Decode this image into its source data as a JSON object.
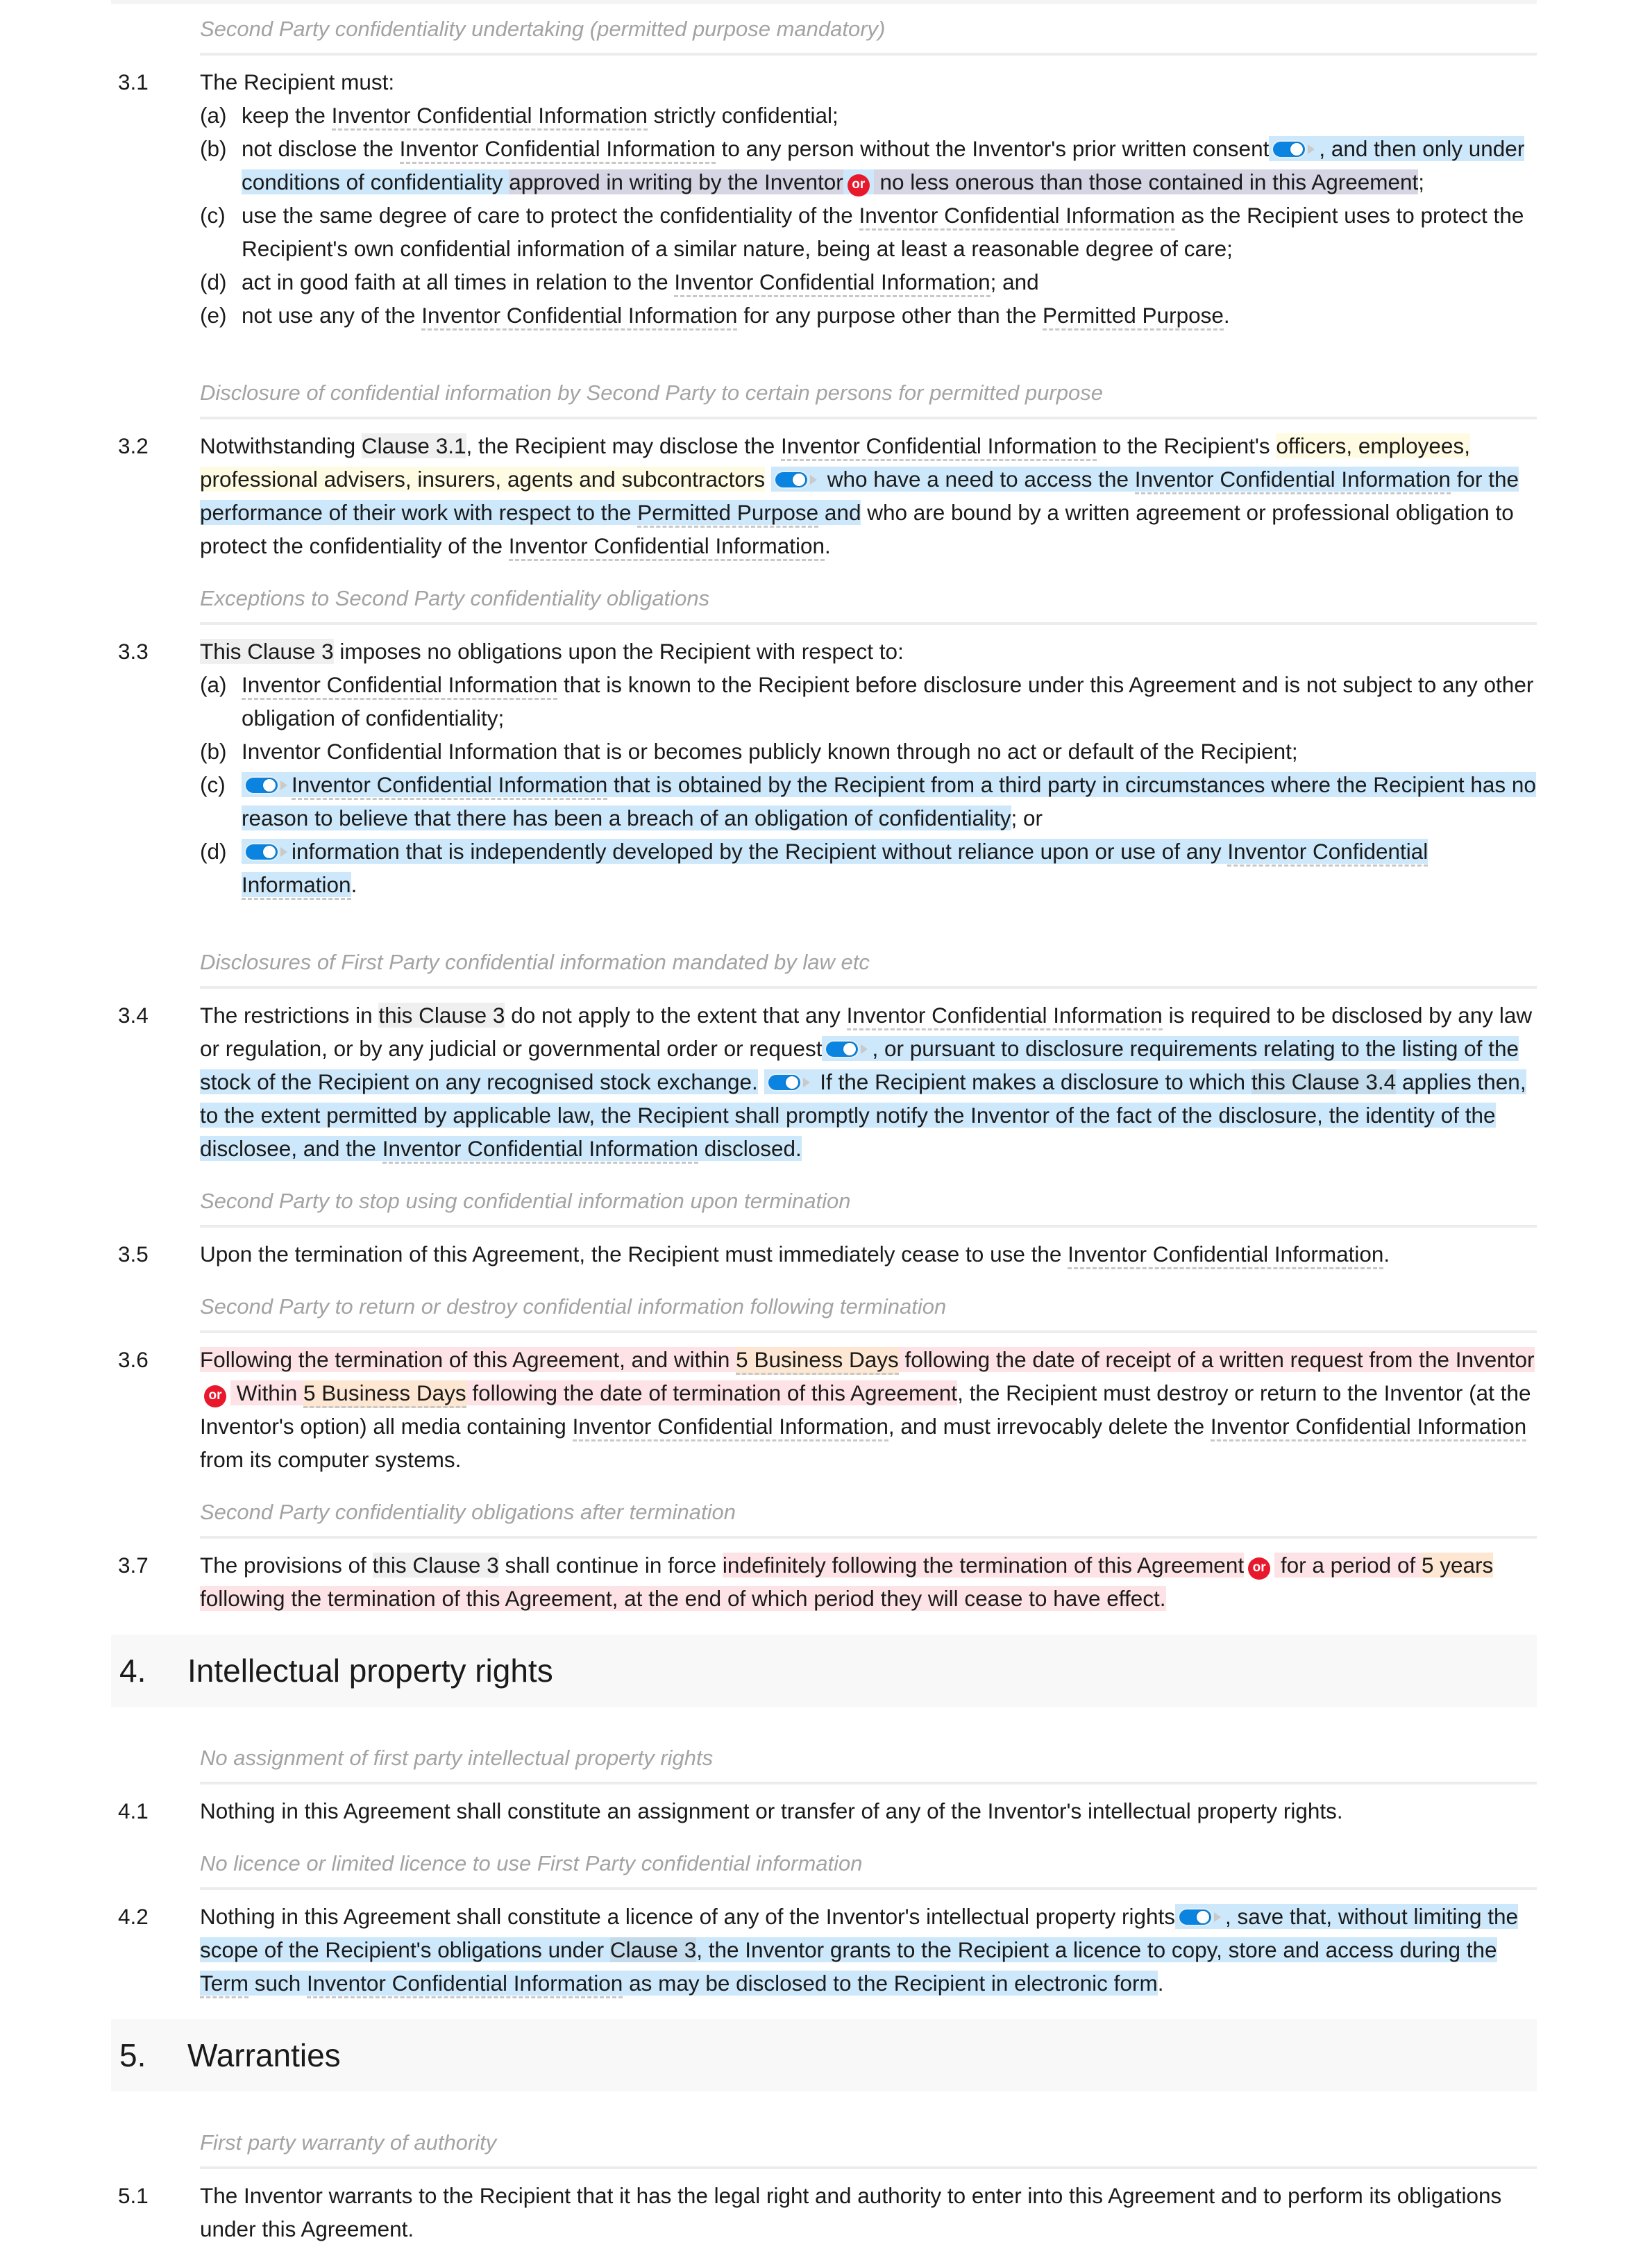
{
  "colors": {
    "optional_clause_bg": "#cde8fa",
    "alternative_bg": "#d5d5e3",
    "variable_bg": "#fffbe3",
    "choice_bg": "#fde3e5",
    "value_bg": "#fde7d2",
    "toggle_on": "#0a84e0",
    "or_badge": "#e8192c",
    "guidance_text": "#a3a3a3"
  },
  "or_label": "or",
  "s3_1": {
    "guidance": "Second Party confidentiality undertaking (permitted purpose mandatory)",
    "num": "3.1",
    "intro": "The Recipient must:",
    "a": {
      "lbl": "(a)",
      "t1": "keep the ",
      "term": "Inventor Confidential Information",
      "t2": " strictly confidential;"
    },
    "b": {
      "lbl": "(b)",
      "t1": "not disclose the ",
      "term": "Inventor Confidential Information",
      "t2": " to any person without the Inventor's prior written consent",
      "opt1": ", and then only under conditions of confidentiality ",
      "alt1": "approved in writing by the Inventor",
      "alt2a": " no less onerous than those contained in this Agreement",
      "t3": ";"
    },
    "c": {
      "lbl": "(c)",
      "t1": "use the same degree of care to protect the confidentiality of the ",
      "term": "Inventor Confidential Information",
      "t2": " as the Recipient uses to protect the Recipient's own confidential information of a similar nature, being at least a reasonable degree of care;"
    },
    "d": {
      "lbl": "(d)",
      "t1": "act in good faith at all times in relation to the ",
      "term": "Inventor Confidential Information",
      "t2": "; and"
    },
    "e": {
      "lbl": "(e)",
      "t1": "not use any of the ",
      "term": "Inventor Confidential Information",
      "t2": " for any purpose other than the ",
      "term2": "Permitted Purpose",
      "t3": "."
    }
  },
  "s3_2": {
    "guidance": "Disclosure of confidential information by Second Party to certain persons for permitted purpose",
    "num": "3.2",
    "t1": "Notwithstanding ",
    "xref": "Clause 3.1",
    "t2": ", the Recipient may disclose the ",
    "term": "Inventor Confidential Information",
    "t3": " to the Recipient's ",
    "var": "officers, employees, professional advisers, insurers, agents and subcontractors",
    "opt1": " who have a need to access the ",
    "opt_term": "Inventor Confidential Information",
    "opt2": " for the performance of their work with respect to the ",
    "opt_term2": "Permitted Purpose",
    "opt3": " and",
    "t4": " who are bound by a written agreement or professional obligation to protect the confidentiality of the ",
    "term2": "Inventor Confidential Information",
    "t5": "."
  },
  "s3_3": {
    "guidance": "Exceptions to Second Party confidentiality obligations",
    "num": "3.3",
    "xref": "This Clause 3",
    "intro": " imposes no obligations upon the Recipient with respect to:",
    "a": {
      "lbl": "(a)",
      "term": "Inventor Confidential Information",
      "t1": " that is known to the Recipient before disclosure under this Agreement and is not subject to any other obligation of confidentiality;"
    },
    "b": {
      "lbl": "(b)",
      "t1": "Inventor Confidential Information that is or becomes publicly known through no act or default of the Recipient;"
    },
    "c": {
      "lbl": "(c)",
      "term": "Inventor Confidential Information",
      "t1": " that is obtained by the Recipient from a third party in circumstances where the Recipient has no reason to believe that there has been a breach of an obligation of confidentiality",
      "t2": "; or"
    },
    "d": {
      "lbl": "(d)",
      "t1": "information that is independently developed by the Recipient without reliance upon or use of any ",
      "term": "Inventor Confidential Information",
      "t2": "."
    }
  },
  "s3_4": {
    "guidance": "Disclosures of First Party confidential information mandated by law etc",
    "num": "3.4",
    "t1": "The restrictions in ",
    "xref": "this Clause 3",
    "t2": " do not apply to the extent that any ",
    "term": "Inventor Confidential Information",
    "t3": " is required to be disclosed by any law or regulation, or by any judicial or governmental order or request",
    "opt1": ", or pursuant to disclosure requirements relating to the listing of the stock of the Recipient on any recognised stock exchange",
    "t4": ".",
    "opt2a": " If the Recipient makes a disclosure to which ",
    "opt2_xref": "this Clause 3.4",
    "opt2b": " applies then, to the extent permitted by applicable law, the Recipient shall promptly notify the Inventor of the fact of the disclosure, the identity of the disclosee, and the ",
    "opt2_term": "Inventor Confidential Information",
    "opt2c": " disclosed."
  },
  "s3_5": {
    "guidance": "Second Party to stop using confidential information upon termination",
    "num": "3.5",
    "t1": "Upon the termination of this Agreement, the Recipient must immediately cease to use the ",
    "term": "Inventor Confidential Information",
    "t2": "."
  },
  "s3_6": {
    "guidance": "Second Party to return or destroy confidential information following termination",
    "num": "3.6",
    "alt1a": "Following the termination of this Agreement, and within ",
    "alt1_val": "5 Business Days",
    "alt1b": " following the date of receipt of a written request from the Inventor",
    "alt2a": " Within ",
    "alt2_val": "5 Business Days",
    "alt2b": " following the date of termination of this Agreement",
    "t1": ", the Recipient must destroy or return to the Inventor (at the Inventor's option) all media containing ",
    "term": "Inventor Confidential Information",
    "t2": ", and must irrevocably delete the ",
    "term2": "Inventor Confidential Information",
    "t3": " from its computer systems."
  },
  "s3_7": {
    "guidance": "Second Party confidentiality obligations after termination",
    "num": "3.7",
    "t1": "The provisions of ",
    "xref": "this Clause 3",
    "t2": " shall continue in force ",
    "alt1": "indefinitely following the termination of this Agreement",
    "alt2a": " for a period of ",
    "alt2_val": "5 years",
    "alt2b": " following the termination of this Agreement, at the end of which period they will cease to have effect",
    "t3": "."
  },
  "h4": {
    "num": "4.",
    "title": "Intellectual property rights"
  },
  "s4_1": {
    "guidance": "No assignment of first party intellectual property rights",
    "num": "4.1",
    "t1": "Nothing in this Agreement shall constitute an assignment or transfer of any of the Inventor's intellectual property rights."
  },
  "s4_2": {
    "guidance": "No licence or limited licence to use First Party confidential information",
    "num": "4.2",
    "t1": "Nothing in this Agreement shall constitute a licence of any of the Inventor's intellectual property rights",
    "opt1": ", save that, without limiting the scope of the Recipient's obligations under ",
    "opt_xref": "Clause 3",
    "opt2": ", the Inventor grants to the Recipient a licence to copy, store and access during the ",
    "opt_term": "Term",
    "opt3": " such ",
    "opt_term2": "Inventor Confidential Information",
    "opt4": " as may be disclosed to the Recipient in electronic form",
    "t2": "."
  },
  "h5": {
    "num": "5.",
    "title": "Warranties"
  },
  "s5_1": {
    "guidance": "First party warranty of authority",
    "num": "5.1",
    "t1": "The Inventor warrants to the Recipient that it has the legal right and authority to enter into this Agreement and to perform its obligations under this Agreement."
  }
}
